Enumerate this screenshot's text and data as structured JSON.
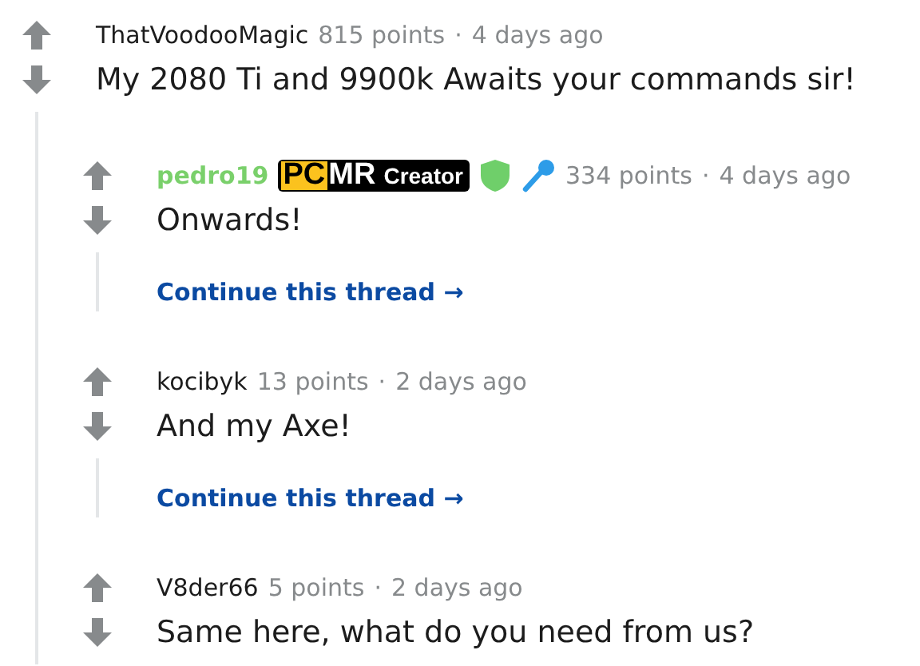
{
  "comments": [
    {
      "author": "ThatVoodooMagic",
      "submitter": false,
      "points": "815 points",
      "separator": "·",
      "age": "4 days ago",
      "body": "My 2080 Ti and 9900k Awaits your commands sir!",
      "children": [
        {
          "author": "pedro19",
          "submitter": true,
          "flair": [
            {
              "text": "PC",
              "kind": "highlight"
            },
            {
              "text": "MR",
              "kind": "strong"
            },
            {
              "text": "Creator",
              "kind": "plain"
            }
          ],
          "badges": [
            {
              "kind": "shield"
            },
            {
              "kind": "mic"
            }
          ],
          "points": "334 points",
          "separator": "·",
          "age": "4 days ago",
          "body": "Onwards!",
          "continue_link": "Continue this thread",
          "link_arrow": "→"
        },
        {
          "author": "kocibyk",
          "submitter": false,
          "points": "13 points",
          "separator": "·",
          "age": "2 days ago",
          "body": "And my Axe!",
          "continue_link": "Continue this thread",
          "link_arrow": "→"
        },
        {
          "author": "V8der66",
          "submitter": false,
          "points": "5 points",
          "separator": "·",
          "age": "2 days ago",
          "body": "Same here, what do you need from us?"
        }
      ]
    }
  ]
}
